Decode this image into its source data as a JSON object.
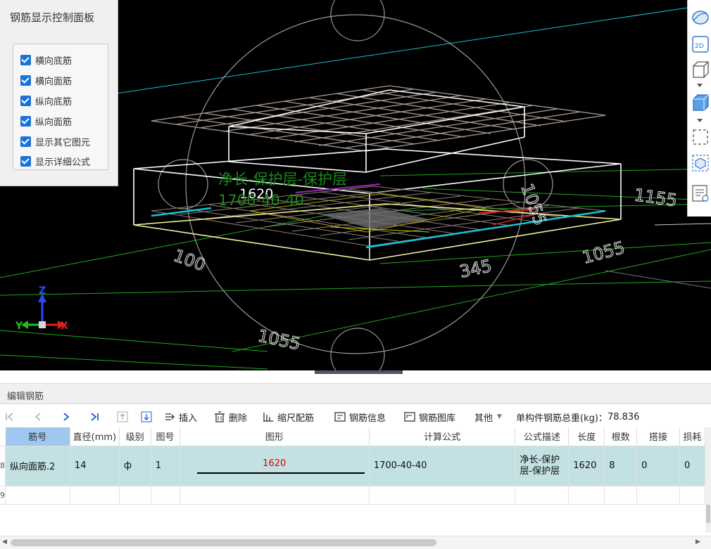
{
  "viewport": {
    "label_formula_desc": "净长-保护层-保护层",
    "label_length": "1620",
    "label_formula": "1700-40-40",
    "dim_labels": [
      "1055",
      "345",
      "1155",
      "100",
      "1055",
      "1055"
    ],
    "axis": {
      "x": "X",
      "y": "Y",
      "z": "Z"
    }
  },
  "control_panel": {
    "title": "钢筋显示控制面板",
    "options": [
      {
        "label": "横向底筋",
        "checked": true
      },
      {
        "label": "横向面筋",
        "checked": true
      },
      {
        "label": "纵向底筋",
        "checked": true
      },
      {
        "label": "纵向面筋",
        "checked": true
      },
      {
        "label": "显示其它图元",
        "checked": true
      },
      {
        "label": "显示详细公式",
        "checked": true
      }
    ]
  },
  "view_toolbar": {
    "icons": [
      "orbit-icon",
      "2d-view-icon",
      "3d-box-icon",
      "3d-solid-icon",
      "select-region-icon",
      "cube-select-icon",
      "list-view-icon"
    ],
    "btn_2d": "2D"
  },
  "edit_panel": {
    "title": "编辑钢筋",
    "toolbar": {
      "insert": "插入",
      "delete": "删除",
      "scale": "缩尺配筋",
      "rebar_info": "钢筋信息",
      "rebar_library": "钢筋图库",
      "other": "其他",
      "total_weight_label": "单构件钢筋总重(kg)：",
      "total_weight_value": "78.836"
    },
    "columns": [
      "筋号",
      "直径(mm)",
      "级别",
      "图号",
      "图形",
      "计算公式",
      "公式描述",
      "长度",
      "根数",
      "搭接",
      "损耗"
    ],
    "rows": [
      {
        "row_no": "8",
        "name": "纵向面筋.2",
        "diameter": "14",
        "grade": "ф",
        "shape_no": "1",
        "shape_value": "1620",
        "formula": "1700-40-40",
        "formula_desc": "净长-保护层-保护层",
        "length": "1620",
        "count": "8",
        "lap": "0",
        "loss": "0"
      },
      {
        "row_no": "9"
      }
    ]
  },
  "colors": {
    "viewport_bg": "#000000",
    "selected_header": "#9fc7f0",
    "selected_row": "#c3e0e2",
    "checkbox": "#1a73d9",
    "formula_text": "#1a8a1a",
    "shape_value": "#e00000"
  }
}
